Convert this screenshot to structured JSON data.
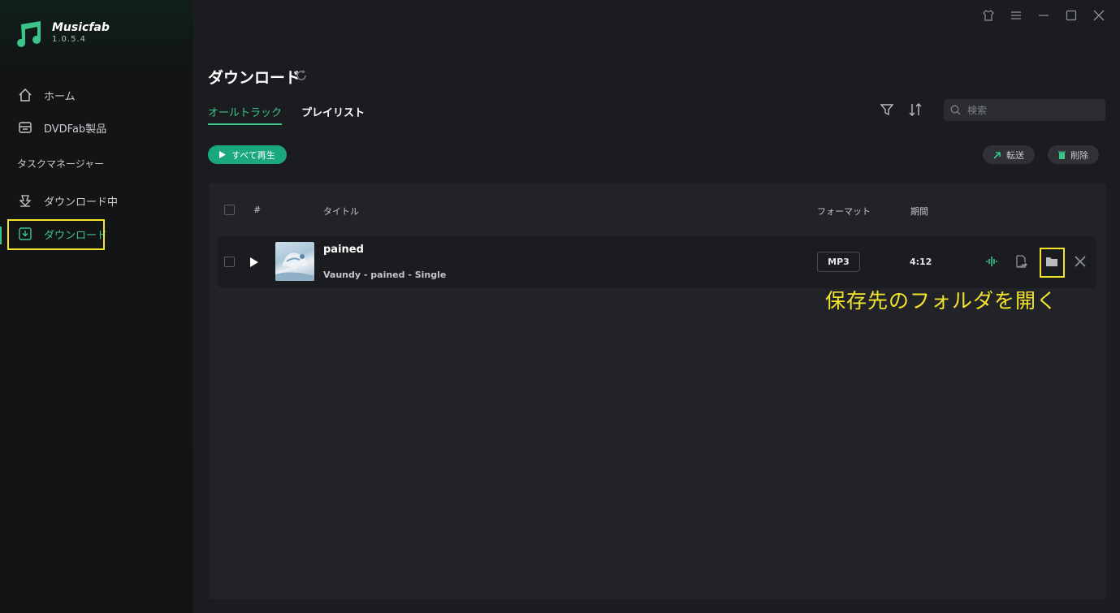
{
  "app": {
    "brand": "Musicfab",
    "version": "1.0.5.4"
  },
  "sidebar": {
    "items": [
      {
        "label": "ホーム",
        "icon": "home-icon"
      },
      {
        "label": "DVDFab製品",
        "icon": "dvdfab-icon"
      }
    ],
    "section_title": "タスクマネージャー",
    "task_items": [
      {
        "label": "ダウンロード中",
        "icon": "downloading-icon"
      },
      {
        "label": "ダウンロード",
        "icon": "downloaded-icon",
        "active": true
      }
    ]
  },
  "header": {
    "title": "ダウンロード",
    "tabs": [
      {
        "label": "オールトラック",
        "active": true
      },
      {
        "label": "プレイリスト",
        "active": false
      }
    ],
    "search_placeholder": "検索"
  },
  "toolbar": {
    "play_all_label": "すべて再生",
    "transfer_label": "転送",
    "delete_label": "削除"
  },
  "table": {
    "columns": [
      "#",
      "タイトル",
      "フォーマット",
      "期間"
    ],
    "rows": [
      {
        "title": "pained",
        "subtitle": "Vaundy - pained - Single",
        "format": "MP3",
        "duration": "4:12"
      }
    ]
  },
  "annotation": {
    "text": "保存先のフォルダを開く"
  },
  "colors": {
    "accent": "#3bc58b",
    "highlight": "#f3e42c",
    "background": "#1b1c20",
    "sidebar": "#121315"
  }
}
